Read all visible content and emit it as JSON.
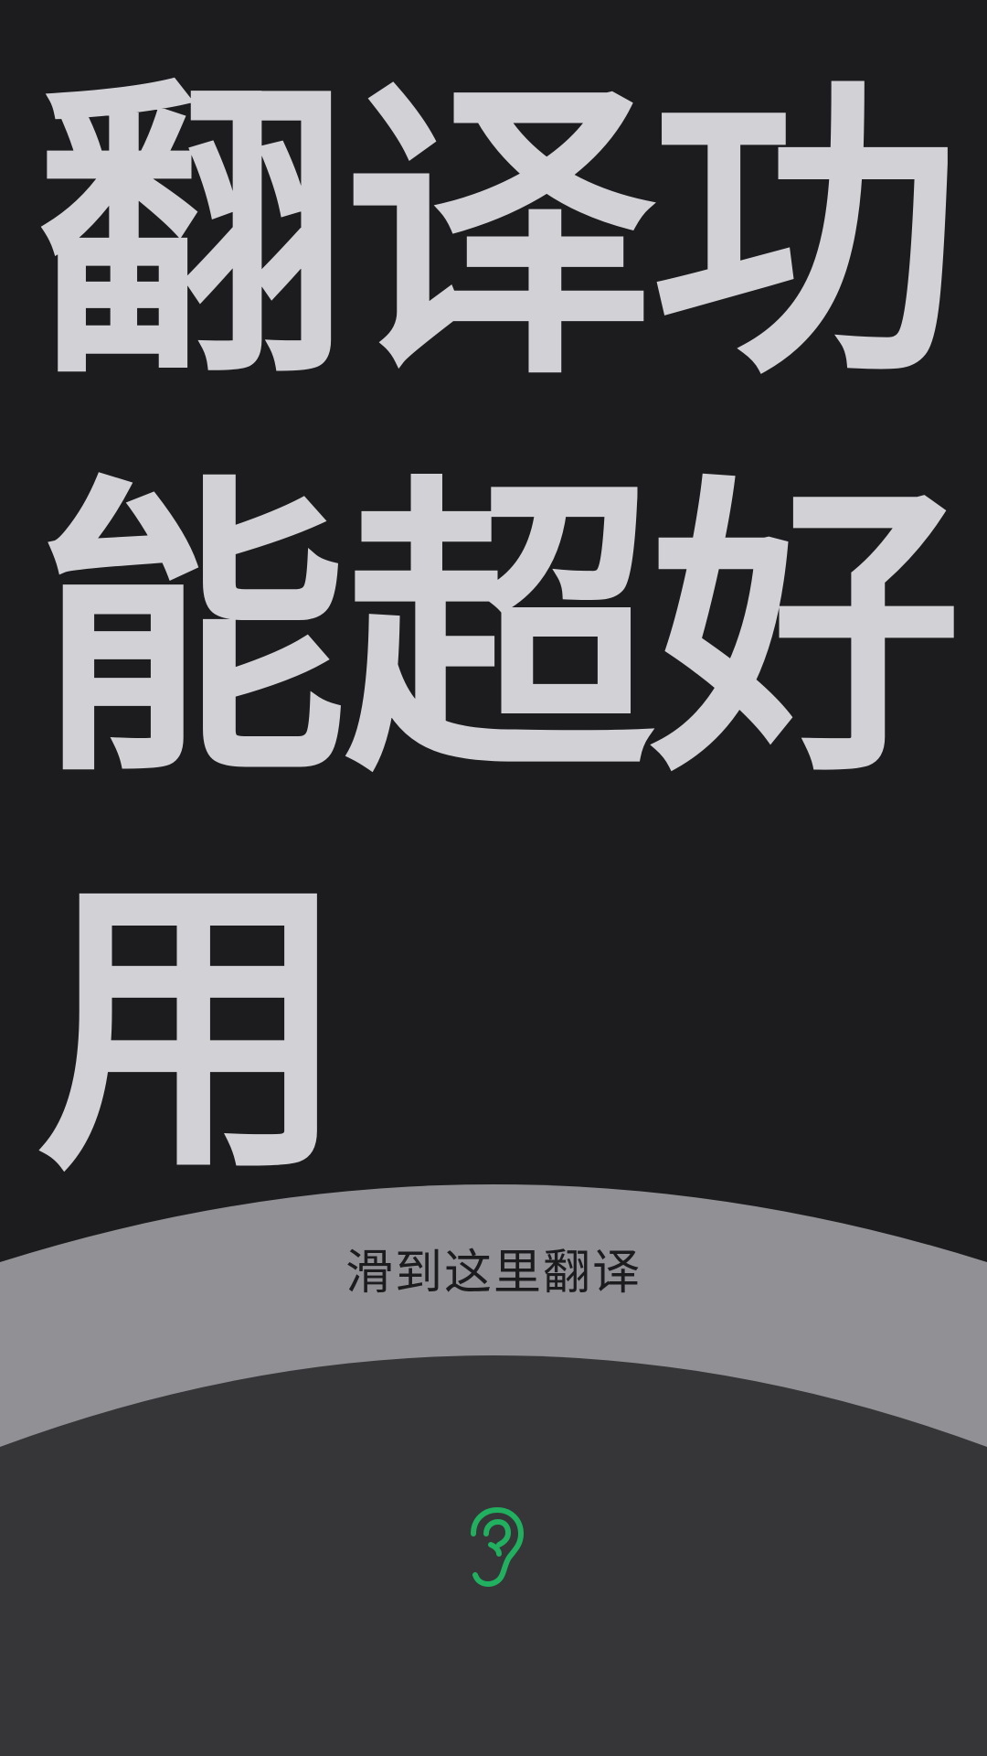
{
  "translation": {
    "text": "翻译功能超好用"
  },
  "swipe_panel": {
    "hint_label": "滑到这里翻译"
  },
  "controls": {
    "ear_icon": "ear-icon"
  },
  "colors": {
    "background": "#1c1c1e",
    "text": "#d1d1d6",
    "swipe_band": "#919195",
    "bottom_panel": "#363638",
    "accent": "#21b05f"
  }
}
